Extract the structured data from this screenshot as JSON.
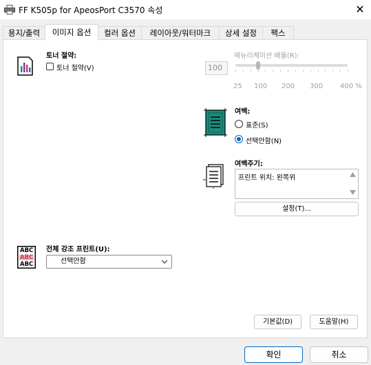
{
  "window": {
    "title": "FF K505p for ApeosPort C3570 속성",
    "close_glyph": "✕"
  },
  "tabs": [
    {
      "label": "용지/출력",
      "active": false
    },
    {
      "label": "이미지 옵션",
      "active": true
    },
    {
      "label": "컬러 옵션",
      "active": false
    },
    {
      "label": "레이아웃/워터마크",
      "active": false
    },
    {
      "label": "상세 설정",
      "active": false
    },
    {
      "label": "팩스",
      "active": false
    }
  ],
  "toner_save": {
    "heading": "토너 절약:",
    "checkbox_label": "토너 절약(V)",
    "checked": false
  },
  "multiplier": {
    "heading": "메뉴리케이션 배율(R):",
    "value": "100",
    "ticks": [
      "25",
      "100",
      "200",
      "300",
      "400 %"
    ],
    "slider_value": 100,
    "enabled": false
  },
  "margin": {
    "heading": "여백:",
    "options": [
      {
        "label": "표준(S)",
        "selected": false
      },
      {
        "label": "선택안함(N)",
        "selected": true
      }
    ]
  },
  "gutter": {
    "heading": "여백주기:",
    "text": "프린트 위치: 왼쪽위",
    "settings_button": "설정(T)..."
  },
  "emphasis": {
    "heading": "전체 강조 프린트(U):",
    "selected": "선택안함",
    "icon_lines": [
      "ABC",
      "ABC",
      "ABC"
    ]
  },
  "buttons": {
    "defaults": "기본값(D)",
    "help": "도움말(H)",
    "ok": "확인",
    "cancel": "취소"
  },
  "colors": {
    "accent": "#0067c0",
    "teal": "#1a8c7e"
  }
}
